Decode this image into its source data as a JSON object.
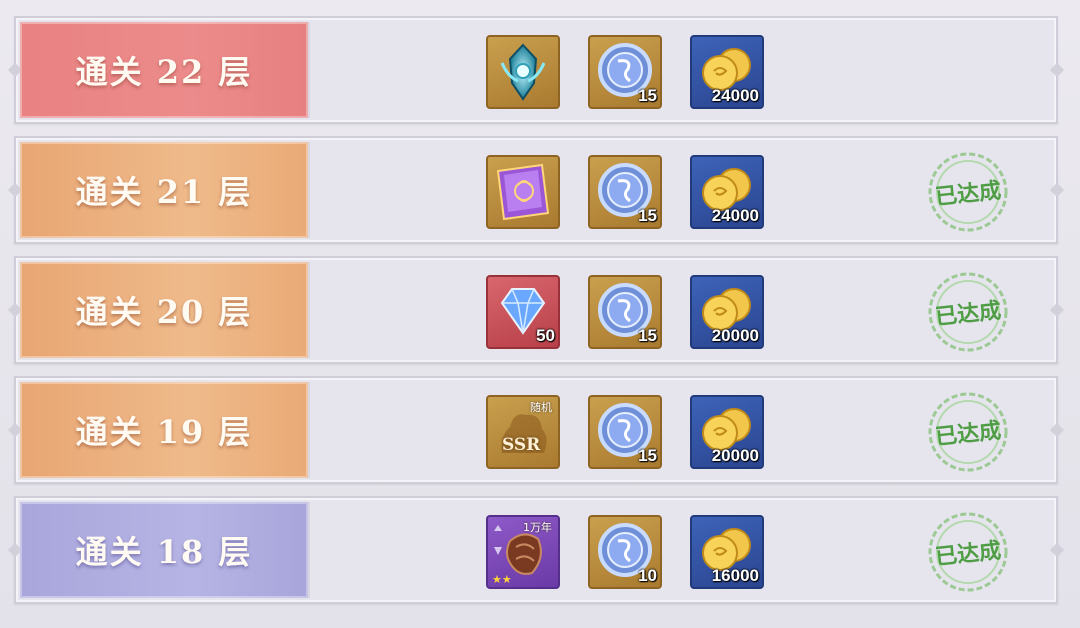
{
  "rows": [
    {
      "label": "通关 22 层",
      "theme": "red",
      "items": [
        {
          "icon": "soul-ring-emblem-icon",
          "frame": "gold",
          "qty": ""
        },
        {
          "icon": "blue-spirit-coin-icon",
          "frame": "gold",
          "qty": "15"
        },
        {
          "icon": "gold-coins-icon",
          "frame": "blue",
          "qty": "24000"
        }
      ],
      "status": ""
    },
    {
      "label": "通关 21 层",
      "theme": "orange",
      "items": [
        {
          "icon": "purple-scroll-icon",
          "frame": "gold",
          "qty": ""
        },
        {
          "icon": "blue-spirit-coin-icon",
          "frame": "gold",
          "qty": "15"
        },
        {
          "icon": "gold-coins-icon",
          "frame": "blue",
          "qty": "24000"
        }
      ],
      "status": "已达成"
    },
    {
      "label": "通关 20 层",
      "theme": "orange",
      "items": [
        {
          "icon": "blue-diamond-icon",
          "frame": "red",
          "qty": "50"
        },
        {
          "icon": "blue-spirit-coin-icon",
          "frame": "gold",
          "qty": "15"
        },
        {
          "icon": "gold-coins-icon",
          "frame": "blue",
          "qty": "20000"
        }
      ],
      "status": "已达成"
    },
    {
      "label": "通关 19 层",
      "theme": "orange",
      "items": [
        {
          "icon": "random-ssr-chest-icon",
          "frame": "gold",
          "qty": "",
          "tag": "随机",
          "text": "SSR"
        },
        {
          "icon": "blue-spirit-coin-icon",
          "frame": "gold",
          "qty": "15"
        },
        {
          "icon": "gold-coins-icon",
          "frame": "blue",
          "qty": "20000"
        }
      ],
      "status": "已达成"
    },
    {
      "label": "通关 18 层",
      "theme": "violet",
      "items": [
        {
          "icon": "soul-bone-icon",
          "frame": "purple",
          "qty": "",
          "tag": "1万年",
          "stars": "★★"
        },
        {
          "icon": "blue-spirit-coin-icon",
          "frame": "gold",
          "qty": "10"
        },
        {
          "icon": "gold-coins-icon",
          "frame": "blue",
          "qty": "16000"
        }
      ],
      "status": "已达成"
    }
  ],
  "colors": {
    "stamp_green": "#4f9e45",
    "panel_red": "#ec8b8b",
    "panel_orange": "#efba8a",
    "panel_violet": "#b6b4e4"
  }
}
